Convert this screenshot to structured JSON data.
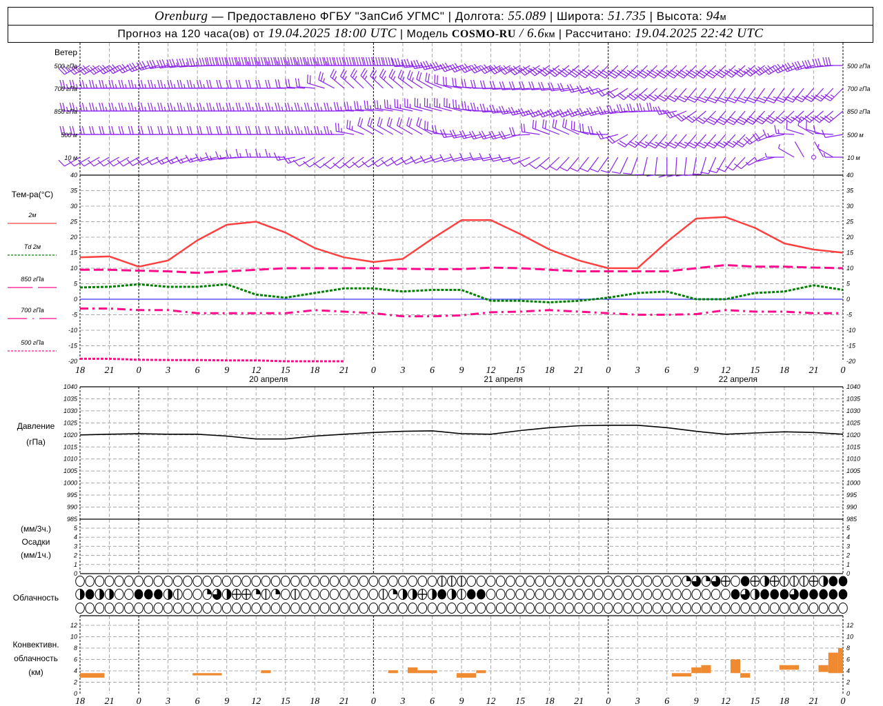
{
  "header": {
    "station": "Orenburg",
    "provider": " — Предоставлено ФГБУ \"ЗапСиб УГМС\" | Долгота: ",
    "lon": "55.089",
    "lat_label": " | Широта: ",
    "lat": "51.735",
    "alt_label": " | Высота: ",
    "alt": "94",
    "alt_unit": "м",
    "forecast_label": "Прогноз на 120 часа(ов) от ",
    "forecast_start": "19.04.2025 18:00 UTC",
    "model_label": "  | Модель ",
    "model": "COSMO-RU",
    "sep": " / ",
    "resolution": "6.6",
    "res_unit": "км",
    "calc_label": " | Рассчитано: ",
    "calc_time": "19.04.2025 22:42 UTC"
  },
  "labels": {
    "wind": "Ветер",
    "wind_levels": [
      "500 гПа",
      "700 гПа",
      "850 гПа",
      "500 м",
      "10  м"
    ],
    "temp_title": "Тем-ра(°C)",
    "temp_legend": [
      "2м",
      "Td  2м",
      "850 гПа",
      "700 гПа",
      "500 гПа"
    ],
    "pressure": [
      "Давление",
      "(гПа)"
    ],
    "precip": [
      "(мм/3ч.)",
      "Осадки",
      "(мм/1ч.)"
    ],
    "cloud": "Облачность",
    "conv": [
      "Конвективн.",
      "облачность",
      "(км)"
    ]
  },
  "colors": {
    "wind": "#8a1ff0",
    "t2m": "#ff4040",
    "td2m": "#008000",
    "upper": "#ff0a8c",
    "pressure": "#000000",
    "conv": "#f08a30",
    "zero": "#0000ff",
    "grid": "#a8a8a8"
  },
  "chart_data": {
    "type": "line",
    "x_unit": "hours UTC",
    "x_tick_labels": [
      "18",
      "21",
      "0",
      "3",
      "6",
      "9",
      "12",
      "15",
      "18",
      "21",
      "0",
      "3",
      "6",
      "9",
      "12",
      "15",
      "18",
      "21",
      "0",
      "3",
      "6",
      "9",
      "12",
      "15",
      "18",
      "21",
      "0"
    ],
    "date_labels": [
      "20 апреля",
      "21 апреля",
      "22 апреля"
    ],
    "wind": {
      "unit": "m/s",
      "levels": [
        {
          "name": "500 гПа",
          "dir": [
            240,
            240,
            245,
            260,
            265,
            270,
            270,
            270,
            270,
            270,
            270,
            270,
            260,
            250,
            245,
            240,
            235,
            230,
            225,
            225,
            225,
            225,
            225,
            230,
            240,
            255,
            270
          ],
          "speed": [
            14,
            15,
            16,
            16,
            17,
            20,
            22,
            22,
            22,
            21,
            20,
            19,
            17,
            16,
            16,
            17,
            17,
            17,
            18,
            18,
            18,
            17,
            17,
            16,
            15,
            14,
            14
          ]
        },
        {
          "name": "700 гПа",
          "dir": [
            270,
            270,
            270,
            270,
            270,
            270,
            270,
            270,
            275,
            310,
            315,
            310,
            300,
            280,
            270,
            265,
            265,
            260,
            250,
            230,
            225,
            220,
            215,
            215,
            215,
            220,
            225
          ],
          "speed": [
            12,
            12,
            12,
            12,
            12,
            11,
            11,
            11,
            10,
            12,
            12,
            12,
            11,
            10,
            10,
            10,
            10,
            10,
            10,
            11,
            12,
            13,
            13,
            13,
            13,
            12,
            12
          ]
        },
        {
          "name": "850 гПа",
          "dir": [
            270,
            270,
            270,
            270,
            270,
            270,
            270,
            270,
            270,
            270,
            275,
            280,
            285,
            285,
            270,
            260,
            250,
            250,
            255,
            265,
            270,
            235,
            220,
            220,
            225,
            230,
            230
          ],
          "speed": [
            12,
            12,
            12,
            12,
            12,
            12,
            12,
            12,
            12,
            12,
            12,
            12,
            12,
            12,
            12,
            12,
            12,
            12,
            12,
            12,
            12,
            13,
            14,
            14,
            14,
            13,
            12
          ]
        },
        {
          "name": "500 м",
          "dir": [
            270,
            270,
            270,
            270,
            270,
            270,
            270,
            270,
            270,
            270,
            300,
            300,
            300,
            260,
            255,
            255,
            290,
            295,
            270,
            225,
            220,
            220,
            220,
            225,
            260,
            300,
            260
          ],
          "speed": [
            11,
            11,
            11,
            11,
            11,
            11,
            11,
            11,
            12,
            12,
            11,
            11,
            11,
            9,
            9,
            9,
            10,
            11,
            10,
            11,
            12,
            12,
            12,
            11,
            8,
            5,
            6
          ]
        },
        {
          "name": "10  м",
          "dir": [
            240,
            240,
            240,
            245,
            250,
            260,
            270,
            270,
            240,
            230,
            235,
            240,
            250,
            255,
            260,
            255,
            230,
            220,
            215,
            200,
            180,
            190,
            210,
            230,
            270,
            0,
            270
          ],
          "speed": [
            6,
            6,
            6,
            6,
            7,
            8,
            8,
            8,
            6,
            6,
            6,
            6,
            6,
            5,
            5,
            5,
            4,
            4,
            4,
            4,
            4,
            5,
            5,
            4,
            3,
            0,
            3
          ]
        }
      ]
    },
    "temperature": {
      "ylim": [
        -20,
        40
      ],
      "yticks": [
        40,
        35,
        30,
        25,
        20,
        15,
        10,
        5,
        0,
        -5,
        -10,
        -15,
        -20
      ],
      "series": [
        {
          "name": "2м",
          "values": [
            13.5,
            13.8,
            10.5,
            12.5,
            19,
            24,
            25,
            21.5,
            16.5,
            13.5,
            12,
            13,
            19.5,
            25.5,
            25.5,
            21,
            16,
            12.5,
            10,
            10,
            18.5,
            26,
            26.5,
            23,
            18,
            16,
            15
          ]
        },
        {
          "name": "Td  2м",
          "values": [
            3.8,
            4,
            4.8,
            4,
            4,
            4.8,
            1.5,
            0.5,
            2,
            3.5,
            3.5,
            2.5,
            3,
            3,
            -0.5,
            -0.5,
            -1,
            -0.5,
            0.5,
            2,
            2.5,
            0,
            0,
            2,
            2.5,
            4.5,
            3
          ]
        },
        {
          "name": "850 гПа",
          "values": [
            9.5,
            9.5,
            9.2,
            9,
            8.5,
            9,
            9.5,
            10,
            10,
            10,
            10,
            9.8,
            9.7,
            9.7,
            10.2,
            10,
            9.5,
            9,
            9,
            9,
            9,
            10,
            11,
            10.5,
            10.5,
            10.2,
            10
          ]
        },
        {
          "name": "700 гПа",
          "values": [
            -3,
            -3,
            -3.5,
            -3.5,
            -4.5,
            -4.5,
            -4.5,
            -4.5,
            -3.5,
            -4,
            -4.5,
            -5.5,
            -5.5,
            -5.2,
            -4.2,
            -4,
            -3.5,
            -4,
            -4.5,
            -5,
            -5,
            -4.8,
            -3.5,
            -4,
            -4,
            -4.5,
            -4.5
          ]
        },
        {
          "name": "500 гПа",
          "values": [
            -19.2,
            -19.2,
            -19.5,
            -19.6,
            -19.6,
            -19.7,
            -19.7,
            -20,
            -20,
            -20,
            null,
            null,
            null,
            null,
            null,
            null,
            null,
            null,
            null,
            null,
            null,
            null,
            null,
            null,
            null,
            null,
            null
          ]
        }
      ]
    },
    "pressure": {
      "ylim": [
        985,
        1040
      ],
      "yticks": [
        1040,
        1035,
        1030,
        1025,
        1020,
        1015,
        1010,
        1005,
        1000,
        995,
        990,
        985
      ],
      "values": [
        1020,
        1020.3,
        1020.5,
        1020.3,
        1020.3,
        1019.5,
        1018.3,
        1018.3,
        1019.5,
        1020.3,
        1021,
        1021.5,
        1021.7,
        1020.5,
        1020.3,
        1021.8,
        1023,
        1023.8,
        1024,
        1024,
        1023,
        1021.5,
        1020.3,
        1020.8,
        1021.3,
        1021,
        1020.3
      ]
    },
    "precipitation": {
      "ylim": [
        0,
        5
      ],
      "yticks": [
        5,
        4,
        3,
        2,
        1,
        0
      ],
      "values": []
    },
    "cloud_cover": {
      "legend": "0 empty, v/h line, q quarter, r half, t three-quarter, f overcast",
      "rows": [
        "0000000000000000000000000000000000000vvv0000000000000000000000qtqth fhrhvvvhrffv",
        "rfrr00fffrv00qtrhhqvq0v00000000vqrrhrfrvff0000000000000000000000000ftrffftfffff",
        "0000000000000000000000000000000000000000000000000000000000000000000000000000000"
      ]
    },
    "convective_cloud": {
      "unit": "км",
      "ylim": [
        0,
        13
      ],
      "yticks": [
        12,
        10,
        8,
        6,
        4,
        2,
        0
      ],
      "bars": [
        {
          "from_h": 0,
          "to_h": 2.5,
          "base": 2.8,
          "top": 3.6
        },
        {
          "from_h": 11.5,
          "to_h": 14.5,
          "base": 3.2,
          "top": 3.6
        },
        {
          "from_h": 18.5,
          "to_h": 19.5,
          "base": 3.6,
          "top": 4.1
        },
        {
          "from_h": 31.5,
          "to_h": 32.5,
          "base": 3.6,
          "top": 4.1
        },
        {
          "from_h": 33.5,
          "to_h": 34.5,
          "base": 3.6,
          "top": 4.6
        },
        {
          "from_h": 34.5,
          "to_h": 36.5,
          "base": 3.6,
          "top": 4.1
        },
        {
          "from_h": 38.5,
          "to_h": 40.5,
          "base": 2.8,
          "top": 3.6
        },
        {
          "from_h": 40.5,
          "to_h": 41.5,
          "base": 3.6,
          "top": 4.1
        },
        {
          "from_h": 60.5,
          "to_h": 62.5,
          "base": 3.0,
          "top": 3.6
        },
        {
          "from_h": 62.5,
          "to_h": 63.5,
          "base": 3.6,
          "top": 4.6
        },
        {
          "from_h": 63.5,
          "to_h": 64.5,
          "base": 3.6,
          "top": 5.0
        },
        {
          "from_h": 66.5,
          "to_h": 67.5,
          "base": 3.6,
          "top": 6.0
        },
        {
          "from_h": 67.5,
          "to_h": 68.5,
          "base": 2.8,
          "top": 3.6
        },
        {
          "from_h": 71.5,
          "to_h": 73.5,
          "base": 4.2,
          "top": 5.0
        },
        {
          "from_h": 75.5,
          "to_h": 76.5,
          "base": 3.8,
          "top": 5.0
        },
        {
          "from_h": 76.5,
          "to_h": 77.5,
          "base": 3.6,
          "top": 7.2
        },
        {
          "from_h": 77.5,
          "to_h": 78,
          "base": 3.6,
          "top": 8.0
        }
      ]
    }
  }
}
